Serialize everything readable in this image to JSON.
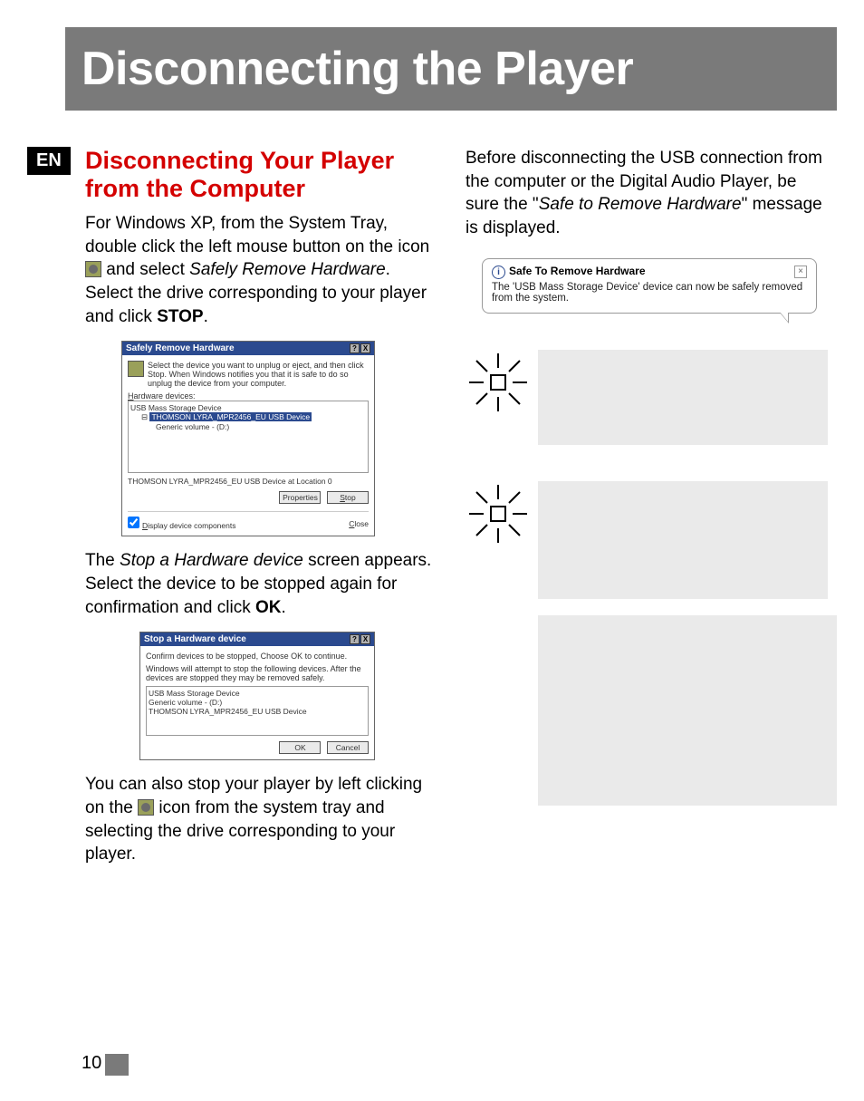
{
  "page": {
    "number": "10",
    "lang_tag": "EN",
    "title": "Disconnecting the Player"
  },
  "left": {
    "heading": "Disconnecting Your Player from the Computer",
    "p1_a": "For Windows XP, from the System Tray, double click the left mouse button on the icon ",
    "p1_b": " and select ",
    "p1_italic": "Safely Remove Hardware",
    "p1_c": ". Select the drive corresponding to your player and click ",
    "p1_bold": "STOP",
    "p1_d": ".",
    "p2_a": "The ",
    "p2_italic": "Stop a Hardware device",
    "p2_b": " screen appears. Select the device to be stopped again for confirmation and click ",
    "p2_bold": "OK",
    "p2_c": ".",
    "p3_a": "You can also stop your player by left clicking on the ",
    "p3_b": " icon from the system tray and selecting the drive corresponding to your player."
  },
  "right": {
    "p1_a": "Before disconnecting the USB connection from the computer or the  Digital Audio Player, be sure the \"",
    "p1_italic": "Safe to Remove Hardware",
    "p1_b": "\" message is displayed."
  },
  "dlg1": {
    "title": "Safely Remove Hardware",
    "instr": "Select the device you want to unplug or eject, and then click Stop. When Windows notifies you that it is safe to do so unplug the device from your computer.",
    "label_hw": "Hardware devices:",
    "item_root": "USB Mass Storage Device",
    "item_sel": "THOMSON LYRA_MPR2456_EU USB Device",
    "item_child": "Generic volume - (D:)",
    "location": "THOMSON LYRA_MPR2456_EU USB Device at Location 0",
    "btn_props": "Properties",
    "btn_stop": "Stop",
    "chk": "Display device components",
    "btn_close": "Close"
  },
  "dlg2": {
    "title": "Stop a Hardware device",
    "instr1": "Confirm devices to be stopped, Choose OK to continue.",
    "instr2": "Windows will attempt to stop the following devices. After the devices are stopped they may be removed safely.",
    "item1": "USB Mass Storage Device",
    "item2": "Generic volume - (D:)",
    "item3": "THOMSON LYRA_MPR2456_EU USB Device",
    "btn_ok": "OK",
    "btn_cancel": "Cancel"
  },
  "balloon": {
    "title": "Safe To Remove Hardware",
    "msg": "The 'USB Mass Storage Device' device can now be safely removed from the system."
  }
}
